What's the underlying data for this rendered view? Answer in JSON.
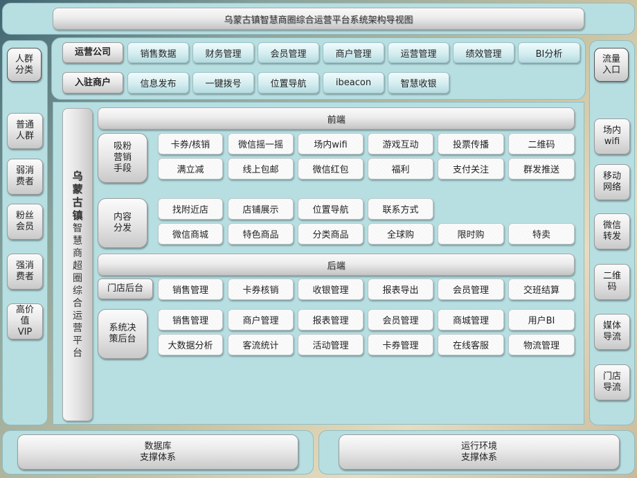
{
  "title": "乌蒙古镇智慧商圈综合运营平台系统架构导视图",
  "top_rows": [
    {
      "header": "运营公司",
      "items": [
        "销售数据",
        "财务管理",
        "会员管理",
        "商户管理",
        "运营管理",
        "绩效管理",
        "BI分析"
      ]
    },
    {
      "header": "入驻商户",
      "items": [
        "信息发布",
        "一键拨号",
        "位置导航",
        "ibeacon",
        "智慧收银"
      ]
    }
  ],
  "left_sidebar": {
    "header": "人群\n分类",
    "items": [
      "普通\n人群",
      "弱消\n费者",
      "粉丝\n会员",
      "强消\n费者",
      "高价\n值\nVIP"
    ]
  },
  "right_sidebar": {
    "header": "流量\n入口",
    "items": [
      "场内\nwifi",
      "移动\n网络",
      "微信\n转发",
      "二维\n码",
      "媒体\n导流",
      "门店\n导流"
    ]
  },
  "platform_label": {
    "bold": [
      "乌",
      "蒙",
      "古",
      "镇"
    ],
    "normal": [
      "智",
      "慧",
      "商",
      "超",
      "圈",
      "综",
      "合",
      "运",
      "营",
      "平",
      "台"
    ]
  },
  "frontend": {
    "title": "前端",
    "groups": [
      {
        "label": "吸粉\n营销\n手段",
        "rows": [
          [
            "卡券/核销",
            "微信摇一摇",
            "场内wifi",
            "游戏互动",
            "投票传播",
            "二维码"
          ],
          [
            "满立减",
            "线上包邮",
            "微信红包",
            "福利",
            "支付关注",
            "群发推送"
          ]
        ]
      },
      {
        "label": "内容\n分发",
        "rows": [
          [
            "找附近店",
            "店铺展示",
            "位置导航",
            "联系方式"
          ],
          [
            "微信商城",
            "特色商品",
            "分类商品",
            "全球购",
            "限时购",
            "特卖"
          ]
        ]
      }
    ]
  },
  "backend": {
    "title": "后端",
    "groups": [
      {
        "label": "门店后台",
        "rows": [
          [
            "销售管理",
            "卡券核销",
            "收银管理",
            "报表导出",
            "会员管理",
            "交班结算"
          ]
        ]
      },
      {
        "label": "系统决\n策后台",
        "rows": [
          [
            "销售管理",
            "商户管理",
            "报表管理",
            "会员管理",
            "商城管理",
            "用户BI"
          ],
          [
            "大数据分析",
            "客流统计",
            "活动管理",
            "卡券管理",
            "在线客服",
            "物流管理"
          ]
        ]
      }
    ]
  },
  "bottom": [
    {
      "label": "数据库\n支撑体系"
    },
    {
      "label": "运行环境\n支撑体系"
    }
  ]
}
